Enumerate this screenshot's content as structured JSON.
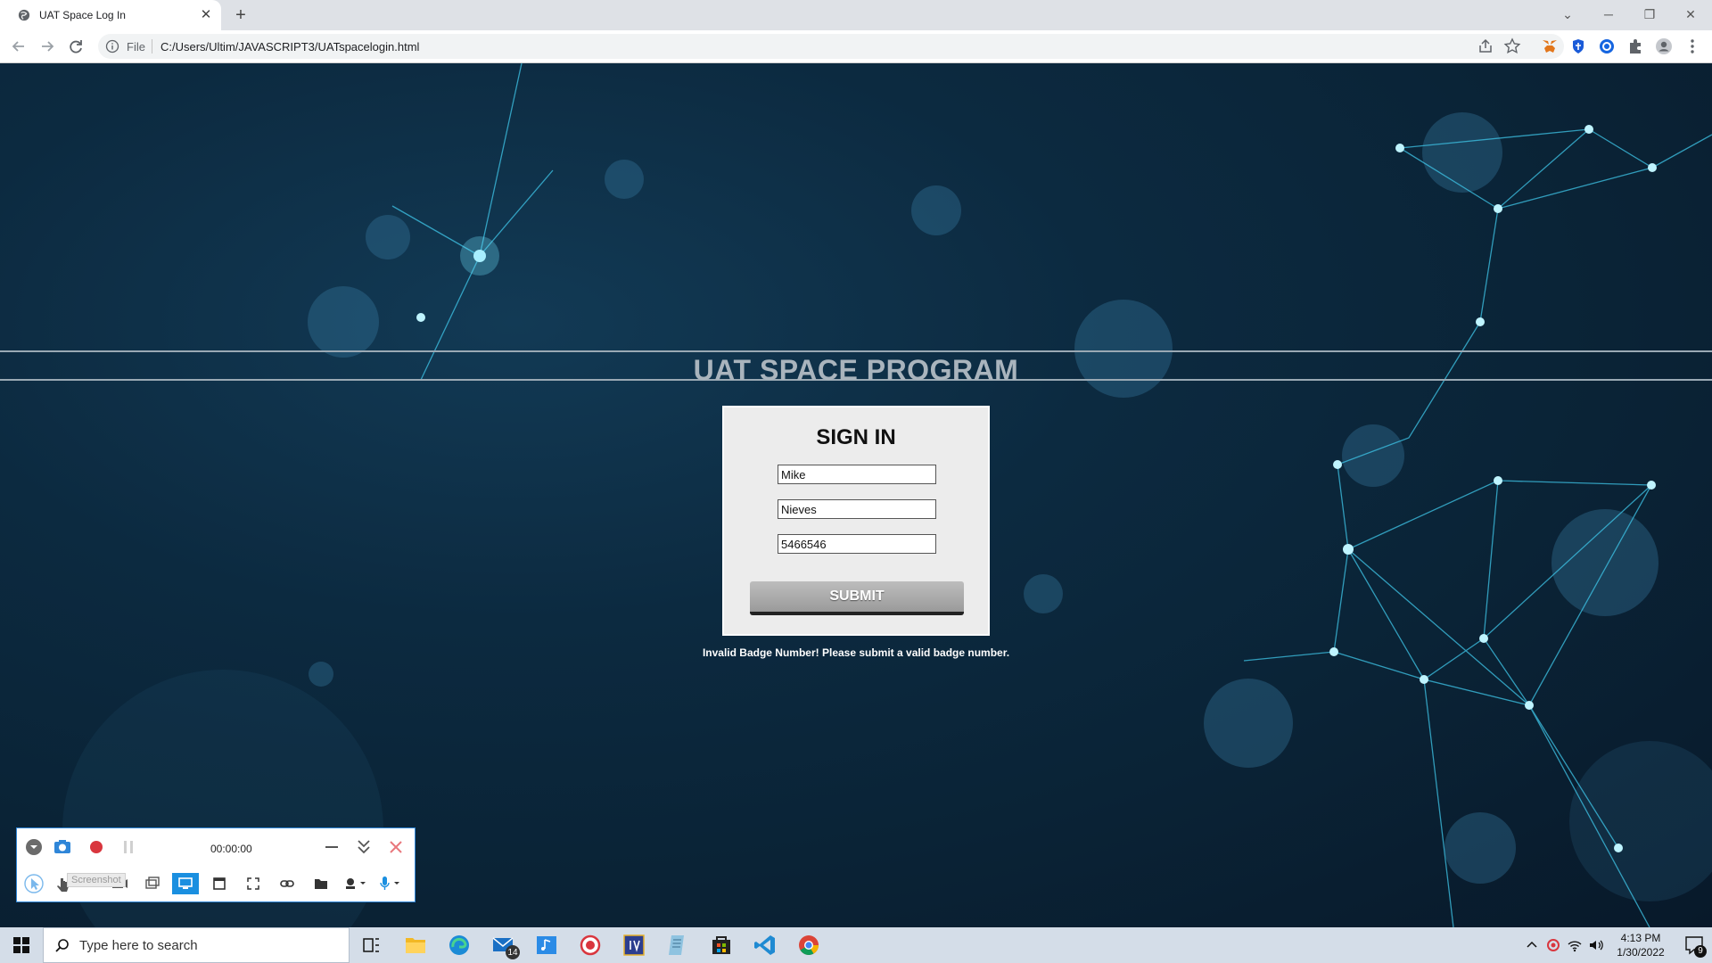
{
  "browser": {
    "tab_title": "UAT Space Log In",
    "tab_close": "✕",
    "new_tab": "+",
    "scheme_label": "File",
    "url": "C:/Users/Ultim/JAVASCRIPT3/UATspacelogin.html",
    "window_controls": {
      "menu": "⌄",
      "minimize": "─",
      "restore": "❐",
      "close": "✕"
    }
  },
  "page": {
    "site_title": "UAT SPACE PROGRAM",
    "signin": {
      "heading": "SIGN IN",
      "first_name_value": "Mike",
      "last_name_value": "Nieves",
      "badge_value": "5466546",
      "submit_label": "SUBMIT"
    },
    "error_message": "Invalid Badge Number! Please submit a valid badge number."
  },
  "recorder": {
    "timer": "00:00:00",
    "tooltip": "Screenshot"
  },
  "taskbar": {
    "search_placeholder": "Type here to search",
    "mail_badge": "14",
    "time": "4:13 PM",
    "date": "1/30/2022",
    "notification_count": "9"
  },
  "colors": {
    "page_bg": "#0b1f2e",
    "title_text": "#a9b4bd",
    "card_bg": "#ececec",
    "submit_bg": "#aaaaaa",
    "error_text": "#ffffff",
    "recorder_accent": "#1a8fe0",
    "record_red": "#d9363e"
  }
}
